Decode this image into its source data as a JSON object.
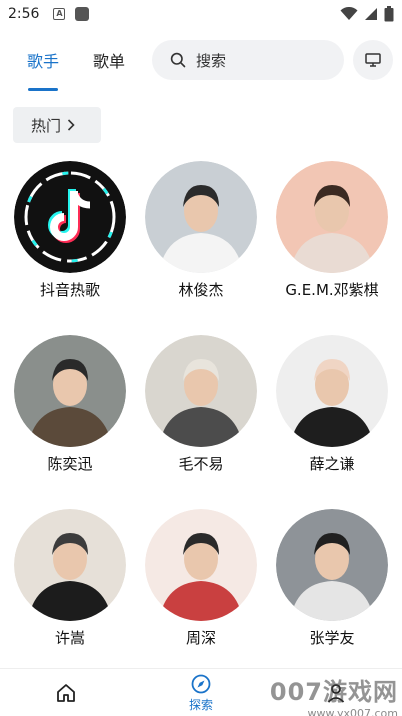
{
  "status_bar": {
    "time": "2:56"
  },
  "header": {
    "tabs": [
      {
        "label": "歌手"
      },
      {
        "label": "歌单"
      }
    ],
    "search_placeholder": "搜索"
  },
  "hot_chip": {
    "label": "热门"
  },
  "artists": [
    {
      "name": "抖音热歌",
      "colors": [
        "#111111",
        "#25f4ee",
        "#fe2c55"
      ]
    },
    {
      "name": "林俊杰",
      "colors": [
        "#c9cfd4",
        "#f4f4f4",
        "#2b2b2b"
      ]
    },
    {
      "name": "G.E.M.邓紫棋",
      "colors": [
        "#f2c6b4",
        "#e9dbd3",
        "#3b2a22"
      ]
    },
    {
      "name": "陈奕迅",
      "colors": [
        "#8a8f8c",
        "#5b4a3a",
        "#2a2a2a"
      ]
    },
    {
      "name": "毛不易",
      "colors": [
        "#d9d6cf",
        "#4c4c4c",
        "#e8e4dc"
      ]
    },
    {
      "name": "薛之谦",
      "colors": [
        "#eeeeee",
        "#1e1e1e",
        "#f0d5c4"
      ]
    },
    {
      "name": "许嵩",
      "colors": [
        "#e6e0d8",
        "#1c1c1c",
        "#3c3c3c"
      ]
    },
    {
      "name": "周深",
      "colors": [
        "#f5e9e4",
        "#c94040",
        "#2a2a2a"
      ]
    },
    {
      "name": "张学友",
      "colors": [
        "#8e9398",
        "#e5e5e5",
        "#202020"
      ]
    }
  ],
  "bottom_nav": {
    "explore_label": "探索",
    "accent": "#1a73c9"
  },
  "watermark": {
    "main": "007游戏网",
    "sub": "www.yx007.com"
  }
}
